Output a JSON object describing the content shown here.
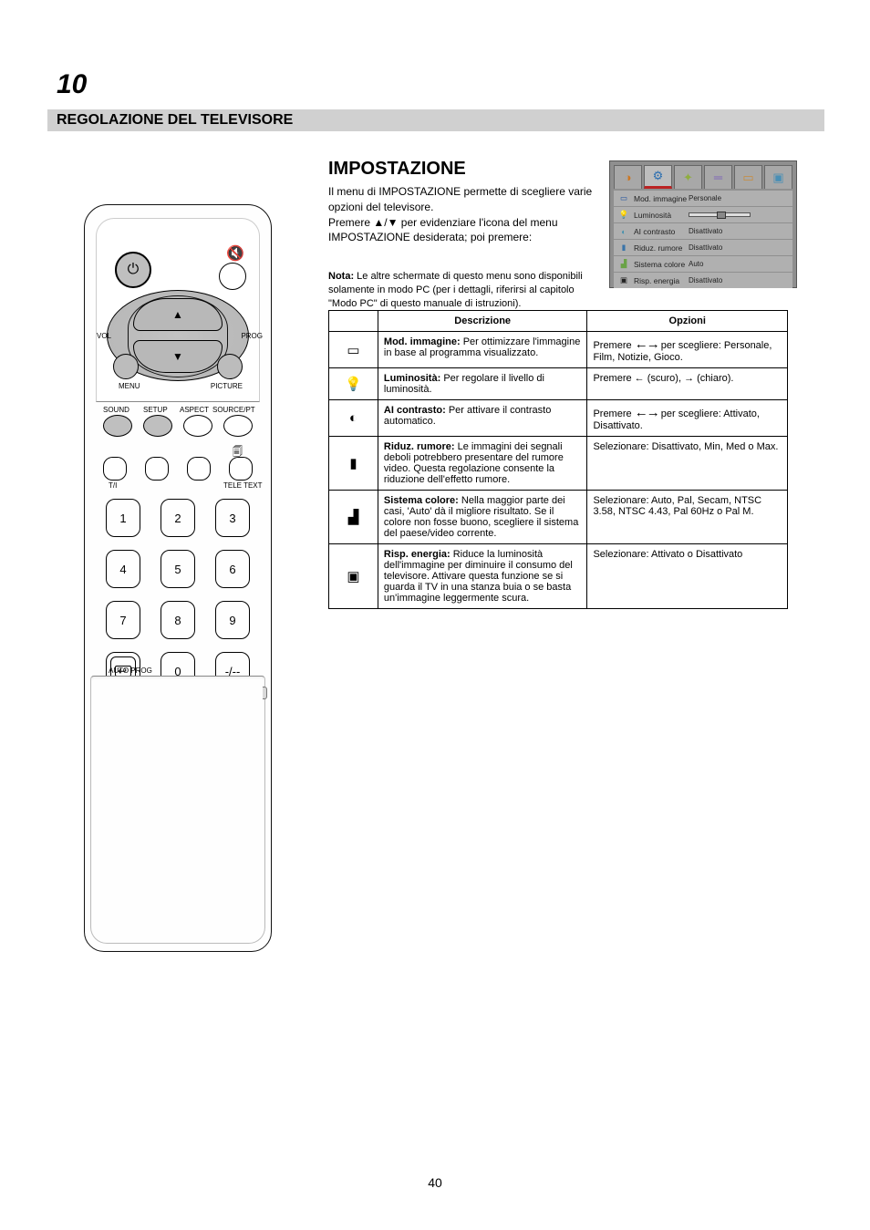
{
  "page": {
    "top_index": "10",
    "header": "REGOLAZIONE DEL TELEVISORE",
    "section_title": "IMPOSTAZIONE",
    "bottom_page_num": "40"
  },
  "intro": {
    "line1": "Il menu di IMPOSTAZIONE permette di scegliere varie opzioni del televisore.",
    "line2_pre": "Premere ",
    "line2_icon": "▲/▼",
    "line2_post": " per evidenziare l'icona del menu IMPOSTAZIONE desiderata; poi premere:"
  },
  "note": {
    "label": "Nota:",
    "text": " Le altre schermate di questo menu sono disponibili solamente in modo PC (per i dettagli, riferirsi al capitolo \"Modo PC\" di questo manuale di istruzioni)."
  },
  "osd": {
    "tabs": [
      {
        "name": "immagine",
        "color": "#cc7722"
      },
      {
        "name": "impostazione",
        "color": "#2a6db0"
      },
      {
        "name": "nitidezza",
        "color": "#8fae3f"
      },
      {
        "name": "schermo",
        "color": "#7d63b8"
      },
      {
        "name": "lingua",
        "color": "#c78c3d"
      },
      {
        "name": "aggiusta",
        "color": "#4a8fb5"
      }
    ],
    "rows": [
      {
        "icon": "mode",
        "label": "Mod. immagine",
        "value": "Personale",
        "iconColor": "#1b4fa0"
      },
      {
        "icon": "bulb",
        "label": "Luminosità",
        "slider": 50,
        "iconColor": "#d7c238"
      },
      {
        "icon": "contrast",
        "label": "AI contrasto",
        "value": "Disattivato",
        "iconColor": "#3f8fae"
      },
      {
        "icon": "nr",
        "label": "Riduz. rumore",
        "value": "Disattivato",
        "iconColor": "#3a74a8"
      },
      {
        "icon": "color",
        "label": "Sistema colore",
        "value": "Auto",
        "iconColor": "#6aa246"
      },
      {
        "icon": "energy",
        "label": "Risp. energia",
        "value": "Disattivato",
        "iconColor": "#222"
      }
    ]
  },
  "table": {
    "headers": [
      "",
      "Descrizione",
      "Opzioni"
    ],
    "rows": [
      {
        "icon": "mode",
        "desc_bold": "Mod. immagine:",
        "desc": " Per ottimizzare l'immagine in base al programma visualizzato.",
        "opt_pre": "Premere ",
        "opt_arrow": true,
        "opt_post": " per scegliere: Personale, Film, Notizie, Gioco."
      },
      {
        "icon": "bulb",
        "desc_bold": "Luminosità:",
        "desc": " Per regolare il livello di luminosità.",
        "opt_pre": "Premere ← (scuro), → (chiaro)."
      },
      {
        "icon": "contrast",
        "desc_bold": "AI contrasto:",
        "desc": " Per attivare il contrasto automatico.",
        "opt_pre": "Premere ",
        "opt_arrow": true,
        "opt_post": " per scegliere: Attivato, Disattivato."
      },
      {
        "icon": "nr",
        "desc_bold": "Riduz. rumore:",
        "desc": " Le immagini dei segnali deboli potrebbero presentare del rumore video. Questa regolazione consente la riduzione dell'effetto rumore.",
        "opt_pre": "Selezionare: Disattivato, Min, Med o Max."
      },
      {
        "icon": "color",
        "desc_bold": "Sistema colore:",
        "desc": " Nella maggior parte dei casi, 'Auto' dà il migliore risultato. Se il colore non fosse buono, scegliere il sistema del paese/video corrente.",
        "opt_pre": "Selezionare: Auto, Pal, Secam, NTSC 3.58, NTSC 4.43, Pal 60Hz o Pal M."
      },
      {
        "icon": "energy",
        "desc_bold": "Risp. energia:",
        "desc": " Riduce la luminosità dell'immagine per diminuire il consumo del televisore. Attivare questa funzione se si guarda il TV in una stanza buia o se basta un'immagine leggermente scura.",
        "opt_pre": "Selezionare: Attivato o Disattivato"
      }
    ]
  },
  "remote": {
    "labels": {
      "power": "⏻",
      "mute": "🔇",
      "menu": "MENU",
      "picture": "PICTURE",
      "sound": "SOUND",
      "setup": "SETUP",
      "aspect": "ASPECT",
      "sourcept": "SOURCE/PT",
      "ti": "T/I",
      "tele": "TELE TEXT",
      "num1": "1",
      "num2": "2",
      "num3": "3",
      "num4": "4",
      "num5": "5",
      "num6": "6",
      "num7": "7",
      "num8": "8",
      "num9": "9",
      "num0": "0",
      "dash": "-/--",
      "autoprog": "AUTO PROG",
      "vol": "VOL",
      "prog": "PROG"
    }
  }
}
